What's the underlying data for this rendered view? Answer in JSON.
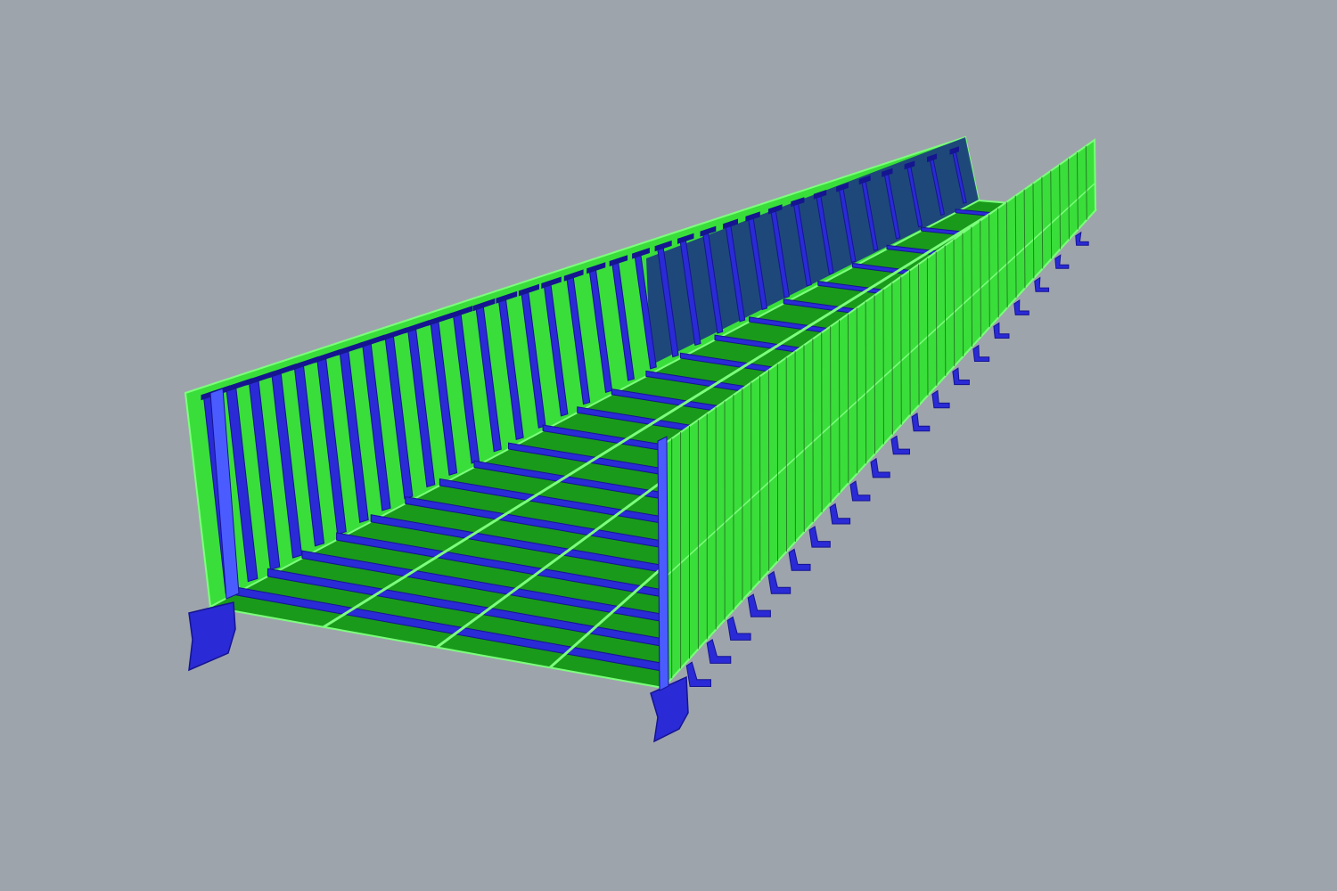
{
  "viewport": {
    "background_color": "#9ea4ac",
    "render_mode": "shaded",
    "subject": "steel-box-girder-segment"
  },
  "model": {
    "skin_color": "#3ade3a",
    "skin_dark_color": "#1a9a1a",
    "skin_edge_color": "#7cff7c",
    "stiffener_color": "#2a2ad6",
    "stiffener_dark_color": "#151590",
    "stiffener_highlight_color": "#4a5cff",
    "far_web_vertical_stiffener_count": 34,
    "deck_transverse_rib_count": 22,
    "deck_longitudinal_rib_count": 3,
    "near_web_panel_line_count": 48,
    "near_web_bottom_bracket_count": 20
  }
}
